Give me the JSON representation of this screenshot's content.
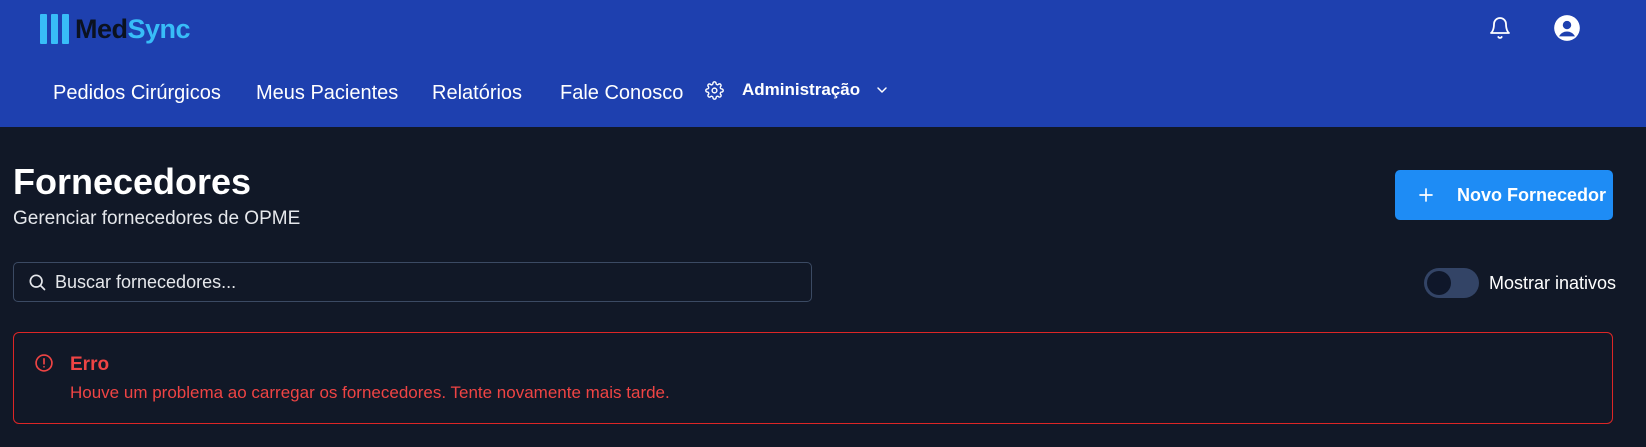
{
  "app": {
    "logo_part1": "Med",
    "logo_part2": "Sync"
  },
  "header": {
    "icons": [
      "bell-icon",
      "user-circle-icon"
    ]
  },
  "nav": {
    "items": [
      {
        "label": "Pedidos Cirúrgicos"
      },
      {
        "label": "Meus Pacientes"
      },
      {
        "label": "Relatórios"
      },
      {
        "label": "Fale Conosco"
      }
    ],
    "admin": {
      "label": "Administração",
      "icon": "gear-icon",
      "chevron": "chevron-down-icon"
    }
  },
  "page": {
    "title": "Fornecedores",
    "subtitle": "Gerenciar fornecedores de OPME",
    "new_button": "Novo Fornecedor"
  },
  "search": {
    "placeholder": "Buscar fornecedores...",
    "value": ""
  },
  "toggle": {
    "label": "Mostrar inativos",
    "checked": false
  },
  "error": {
    "title": "Erro",
    "message": "Houve um problema ao carregar os fornecedores. Tente novamente mais tarde."
  },
  "colors": {
    "header_bg": "#1e40af",
    "page_bg": "#111827",
    "accent": "#1e8cf5",
    "logo_accent": "#38bdf8",
    "error": "#ef4444"
  }
}
